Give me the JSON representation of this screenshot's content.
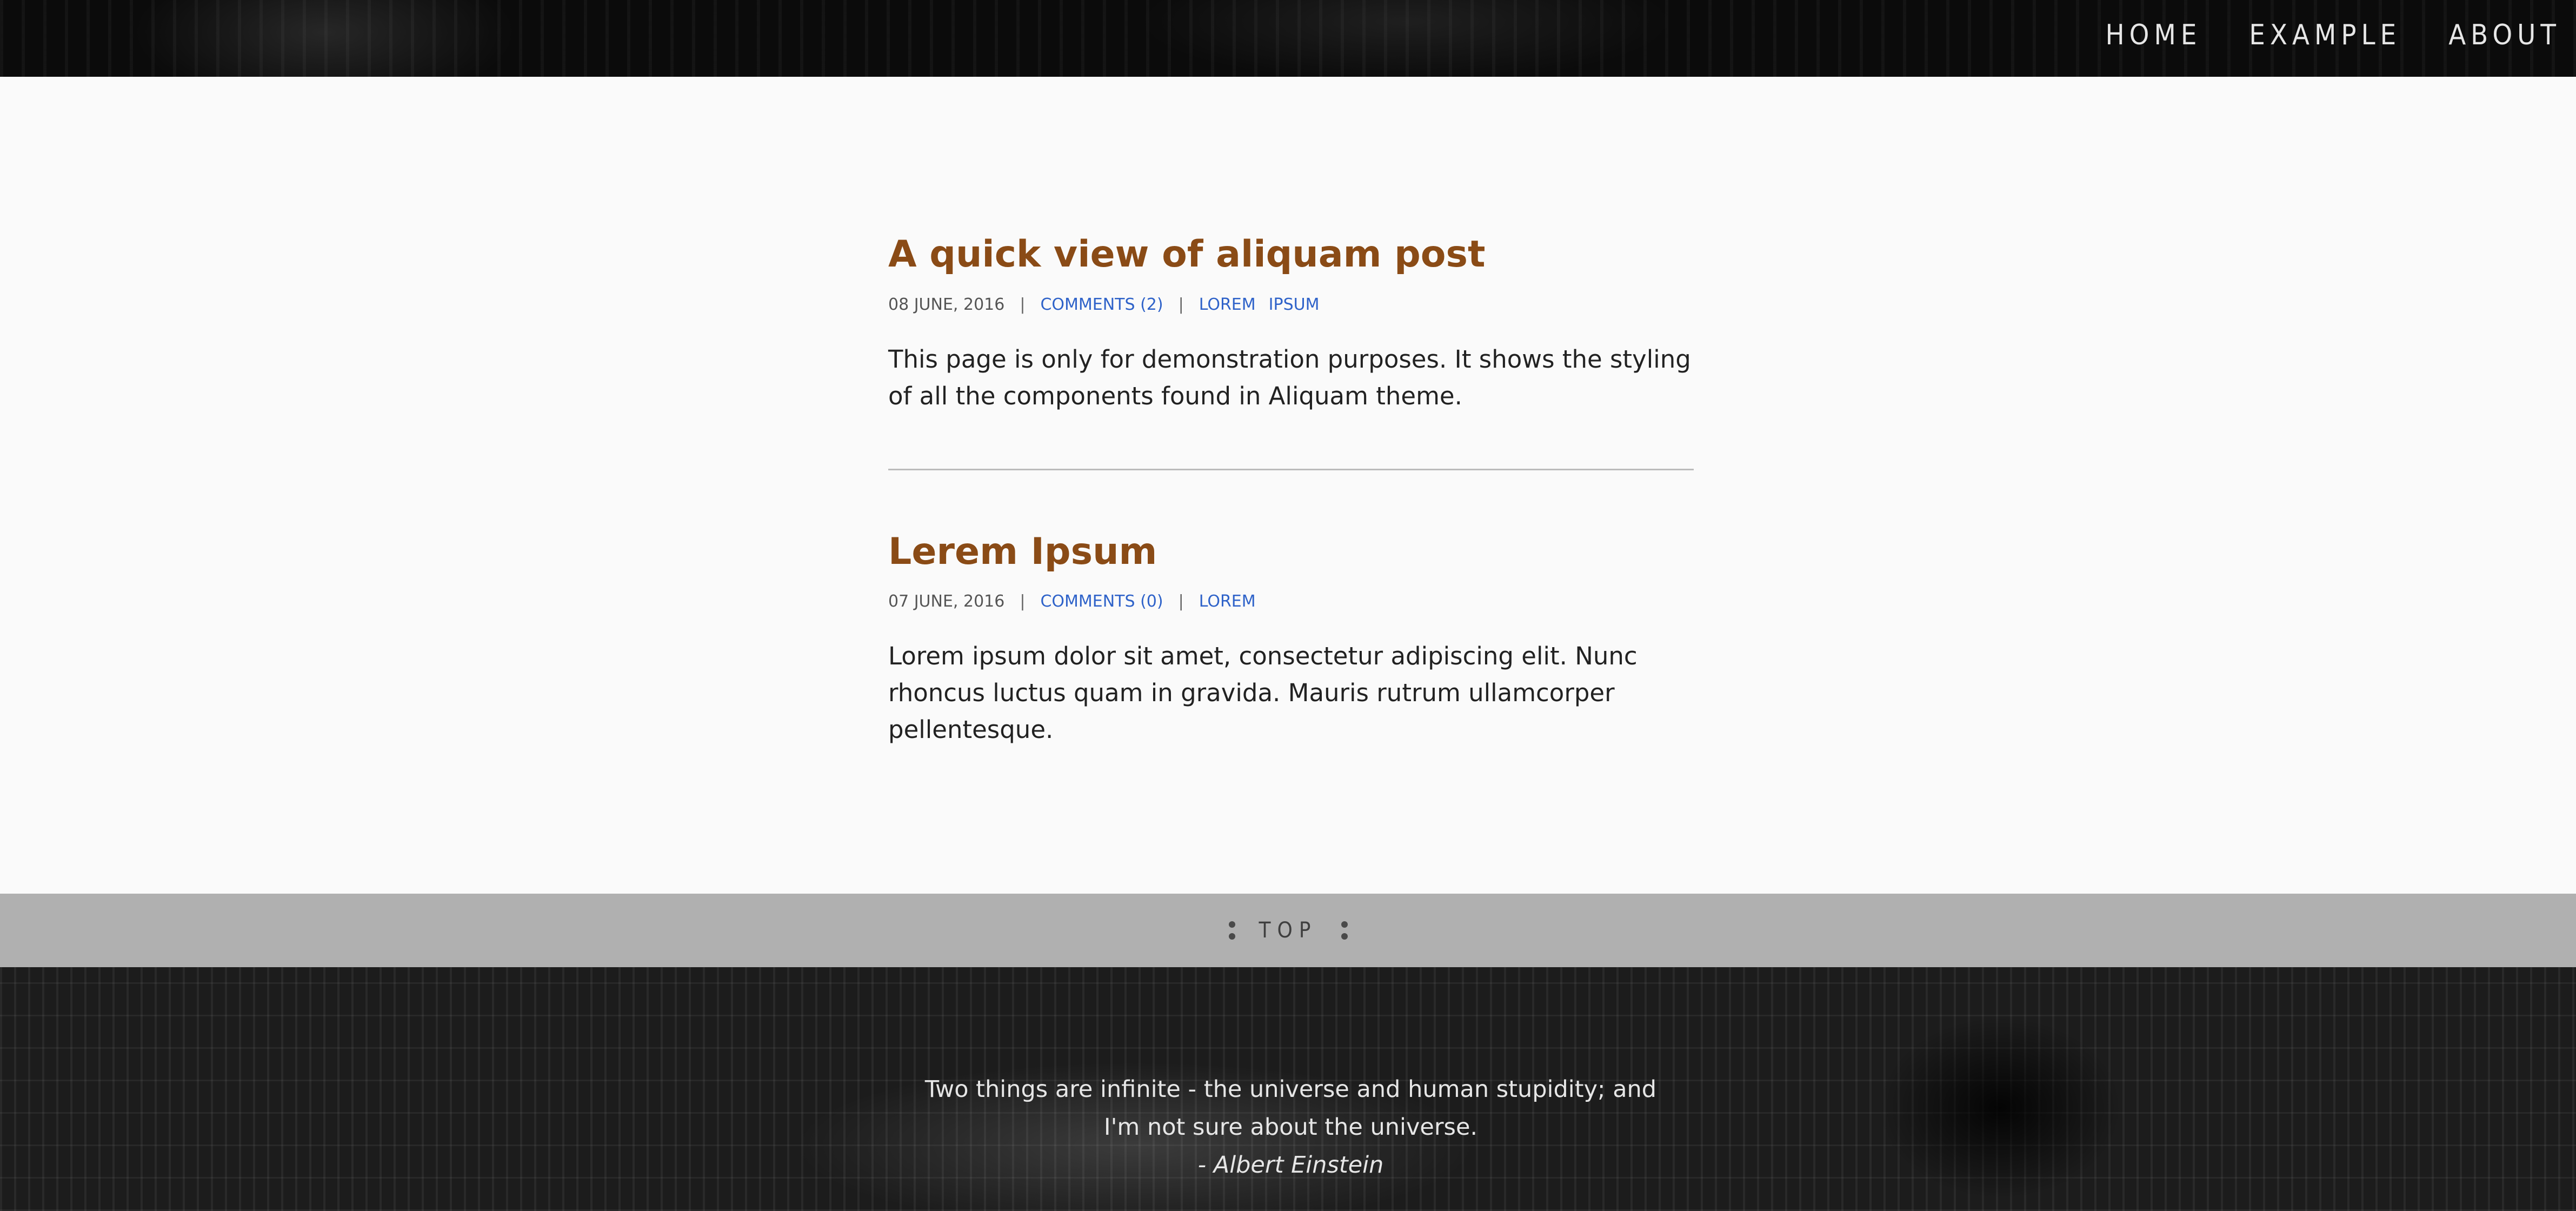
{
  "nav": {
    "items": [
      "HOME",
      "EXAMPLE",
      "ABOUT"
    ]
  },
  "posts": [
    {
      "title": "A quick view of aliquam post",
      "date": "08 JUNE, 2016",
      "comments": "COMMENTS (2)",
      "tags": [
        "LOREM",
        "IPSUM"
      ],
      "excerpt": "This page is only for demonstration purposes. It shows the styling of all the components found in Aliquam theme."
    },
    {
      "title": "Lerem Ipsum",
      "date": "07 JUNE, 2016",
      "comments": "COMMENTS (0)",
      "tags": [
        "LOREM"
      ],
      "excerpt": "Lorem ipsum dolor sit amet, consectetur adipiscing elit. Nunc rhoncus luctus quam in gravida. Mauris rutrum ullamcorper pellentesque."
    }
  ],
  "meta_separator": "|",
  "top_bar": {
    "label": "TOP"
  },
  "footer": {
    "quote": "Two things are infinite - the universe and human stupidity; and I'm not sure about the universe.",
    "author": "- Albert Einstein"
  },
  "colors": {
    "title": "#8a4b16",
    "link": "#2e62c9",
    "top_bar_bg": "#b0b0b0",
    "page_bg": "#fafafa"
  }
}
